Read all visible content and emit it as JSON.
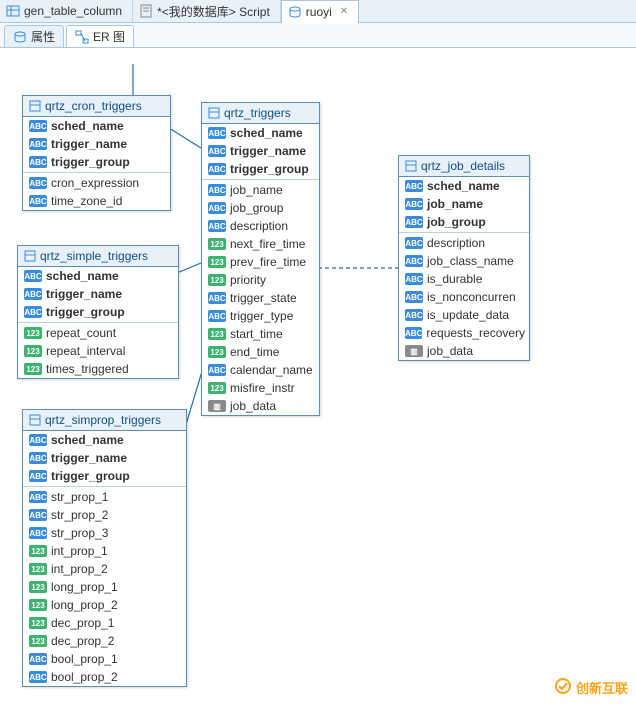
{
  "tabs": [
    {
      "label": "gen_table_column",
      "icon": "table-icon",
      "active": false,
      "closable": false
    },
    {
      "label": "*<我的数据库> Script",
      "icon": "script-icon",
      "active": false,
      "closable": false
    },
    {
      "label": "ruoyi",
      "icon": "db-icon",
      "active": true,
      "closable": true
    }
  ],
  "subtabs": [
    {
      "label": "属性",
      "icon": "db-icon",
      "active": false
    },
    {
      "label": "ER 图",
      "icon": "er-icon",
      "active": true
    }
  ],
  "entities": {
    "cron": {
      "title": "qrtz_cron_triggers",
      "pk": [
        {
          "t": "abc",
          "n": "sched_name"
        },
        {
          "t": "abc",
          "n": "trigger_name"
        },
        {
          "t": "abc",
          "n": "trigger_group"
        }
      ],
      "cols": [
        {
          "t": "abc",
          "n": "cron_expression"
        },
        {
          "t": "abc",
          "n": "time_zone_id"
        }
      ]
    },
    "simple": {
      "title": "qrtz_simple_triggers",
      "pk": [
        {
          "t": "abc",
          "n": "sched_name"
        },
        {
          "t": "abc",
          "n": "trigger_name"
        },
        {
          "t": "abc",
          "n": "trigger_group"
        }
      ],
      "cols": [
        {
          "t": "123",
          "n": "repeat_count"
        },
        {
          "t": "123",
          "n": "repeat_interval"
        },
        {
          "t": "123",
          "n": "times_triggered"
        }
      ]
    },
    "simprop": {
      "title": "qrtz_simprop_triggers",
      "pk": [
        {
          "t": "abc",
          "n": "sched_name"
        },
        {
          "t": "abc",
          "n": "trigger_name"
        },
        {
          "t": "abc",
          "n": "trigger_group"
        }
      ],
      "cols": [
        {
          "t": "abc",
          "n": "str_prop_1"
        },
        {
          "t": "abc",
          "n": "str_prop_2"
        },
        {
          "t": "abc",
          "n": "str_prop_3"
        },
        {
          "t": "123",
          "n": "int_prop_1"
        },
        {
          "t": "123",
          "n": "int_prop_2"
        },
        {
          "t": "123",
          "n": "long_prop_1"
        },
        {
          "t": "123",
          "n": "long_prop_2"
        },
        {
          "t": "123",
          "n": "dec_prop_1"
        },
        {
          "t": "123",
          "n": "dec_prop_2"
        },
        {
          "t": "abc",
          "n": "bool_prop_1"
        },
        {
          "t": "abc",
          "n": "bool_prop_2"
        }
      ]
    },
    "triggers": {
      "title": "qrtz_triggers",
      "pk": [
        {
          "t": "abc",
          "n": "sched_name"
        },
        {
          "t": "abc",
          "n": "trigger_name"
        },
        {
          "t": "abc",
          "n": "trigger_group"
        }
      ],
      "cols": [
        {
          "t": "abc",
          "n": "job_name"
        },
        {
          "t": "abc",
          "n": "job_group"
        },
        {
          "t": "abc",
          "n": "description"
        },
        {
          "t": "123",
          "n": "next_fire_time"
        },
        {
          "t": "123",
          "n": "prev_fire_time"
        },
        {
          "t": "123",
          "n": "priority"
        },
        {
          "t": "abc",
          "n": "trigger_state"
        },
        {
          "t": "abc",
          "n": "trigger_type"
        },
        {
          "t": "123",
          "n": "start_time"
        },
        {
          "t": "123",
          "n": "end_time"
        },
        {
          "t": "abc",
          "n": "calendar_name"
        },
        {
          "t": "123",
          "n": "misfire_instr"
        },
        {
          "t": "bin",
          "n": "job_data"
        }
      ]
    },
    "jobdetails": {
      "title": "qrtz_job_details",
      "pk": [
        {
          "t": "abc",
          "n": "sched_name"
        },
        {
          "t": "abc",
          "n": "job_name"
        },
        {
          "t": "abc",
          "n": "job_group"
        }
      ],
      "cols": [
        {
          "t": "abc",
          "n": "description"
        },
        {
          "t": "abc",
          "n": "job_class_name"
        },
        {
          "t": "abc",
          "n": "is_durable"
        },
        {
          "t": "abc",
          "n": "is_nonconcurren"
        },
        {
          "t": "abc",
          "n": "is_update_data"
        },
        {
          "t": "abc",
          "n": "requests_recovery"
        },
        {
          "t": "bin",
          "n": "job_data"
        }
      ]
    }
  },
  "type_labels": {
    "abc": "ABC",
    "123": "123",
    "bin": "▥"
  },
  "watermark": "创新互联"
}
